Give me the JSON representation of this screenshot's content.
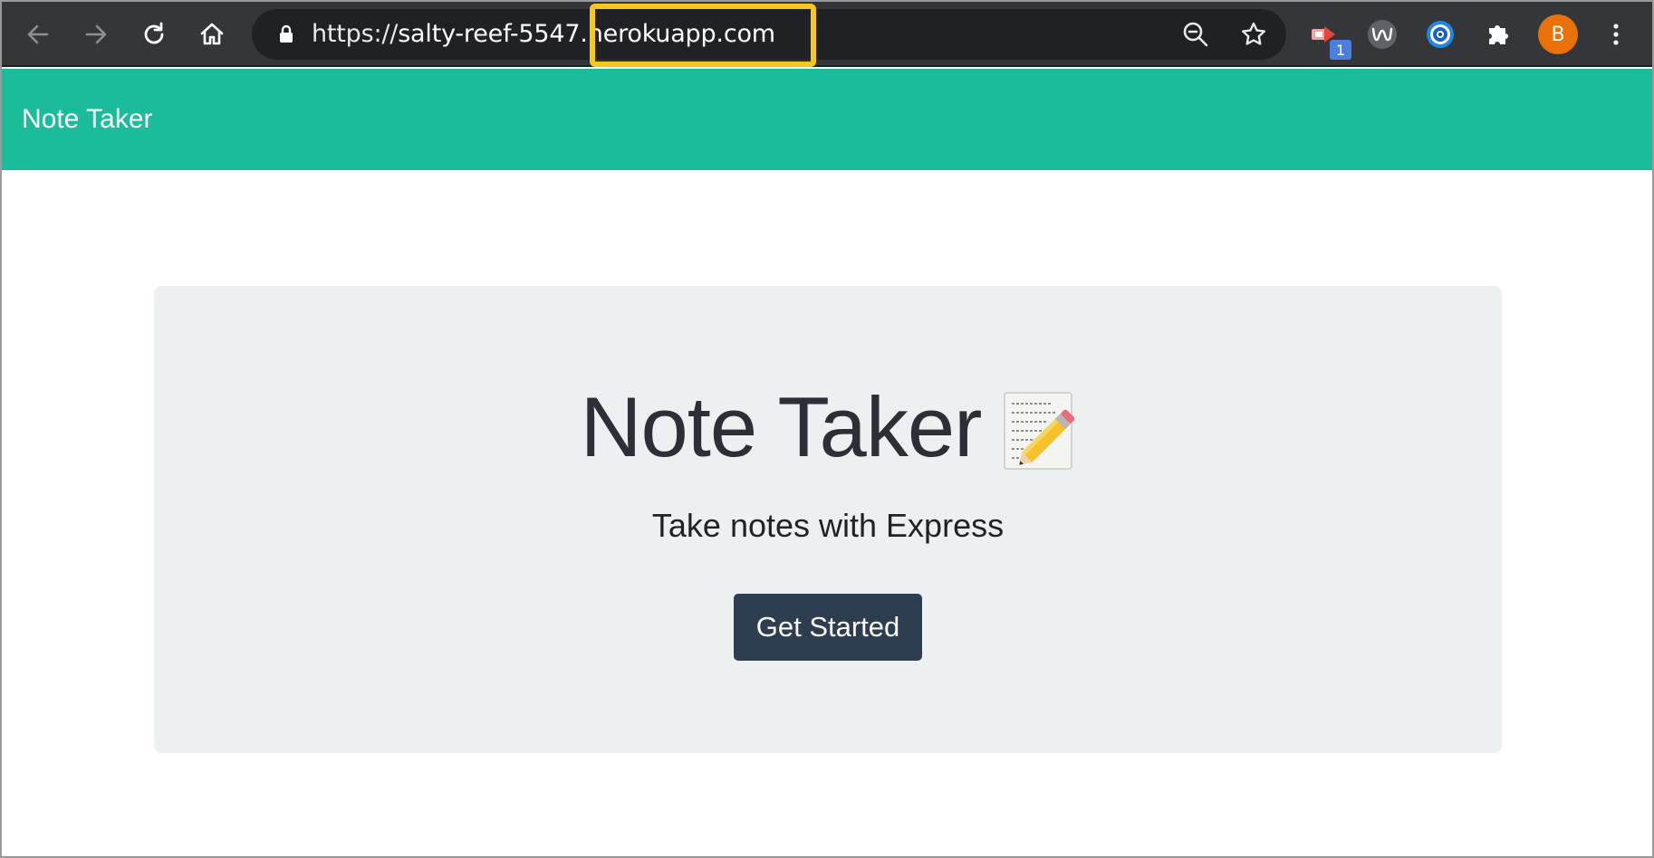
{
  "browser": {
    "url_scheme": "https://",
    "url_host": "salty-reef-5547",
    "url_domain": ".herokuapp.com",
    "profile_initial": "B",
    "extension_badge_count": "1",
    "highlight_color": "#f8c818"
  },
  "navbar": {
    "brand": "Note Taker",
    "color": "#1abc9c"
  },
  "hero": {
    "title": "Note Taker",
    "subtitle": "Take notes with Express",
    "button_label": "Get Started",
    "button_color": "#2c3e50"
  },
  "icons": [
    "back-arrow-icon",
    "forward-arrow-icon",
    "reload-icon",
    "home-icon",
    "lock-icon",
    "zoom-out-icon",
    "star-icon",
    "extension-pin-icon",
    "w-extension-icon",
    "target-extension-icon",
    "puzzle-icon",
    "more-vert-icon",
    "memo-icon"
  ]
}
